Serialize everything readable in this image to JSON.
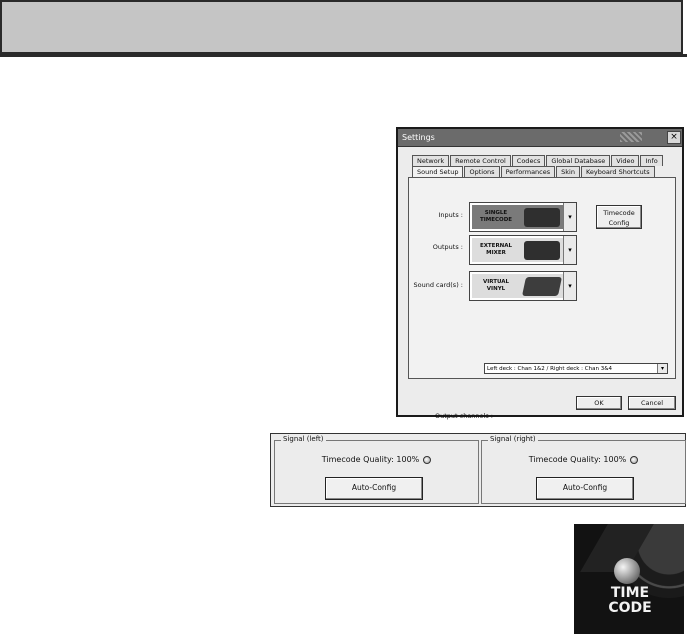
{
  "dialog": {
    "title": "Settings",
    "close_glyph": "×",
    "tabs_row1": [
      "Network",
      "Remote Control",
      "Codecs",
      "Global Database",
      "Video",
      "Info"
    ],
    "tabs_row2": [
      "Sound Setup",
      "Options",
      "Performances",
      "Skin",
      "Keyboard Shortcuts"
    ],
    "active_tab": "Sound Setup",
    "rows": [
      {
        "label": "Inputs :",
        "value": "SINGLE TIMECODE"
      },
      {
        "label": "Outputs :",
        "value": "EXTERNAL MIXER"
      },
      {
        "label": "Sound card(s) :",
        "value": "VIRTUAL VINYL"
      }
    ],
    "timecode_config_label": "Timecode Config",
    "output_channels_label": "Output channels :",
    "output_channels_value": "Left deck : Chan 1&2 / Right deck : Chan 3&4",
    "ok_label": "OK",
    "cancel_label": "Cancel"
  },
  "signal": {
    "left": {
      "legend": "Signal (left)",
      "quality": "Timecode Quality: 100%",
      "button": "Auto-Config"
    },
    "right": {
      "legend": "Signal (right)",
      "quality": "Timecode Quality: 100%",
      "button": "Auto-Config"
    }
  },
  "logo": {
    "text_line1": "TIME",
    "text_line2": "CODE"
  },
  "icons": {
    "dropdown": "chevron-down-icon",
    "led": "status-led-icon"
  }
}
